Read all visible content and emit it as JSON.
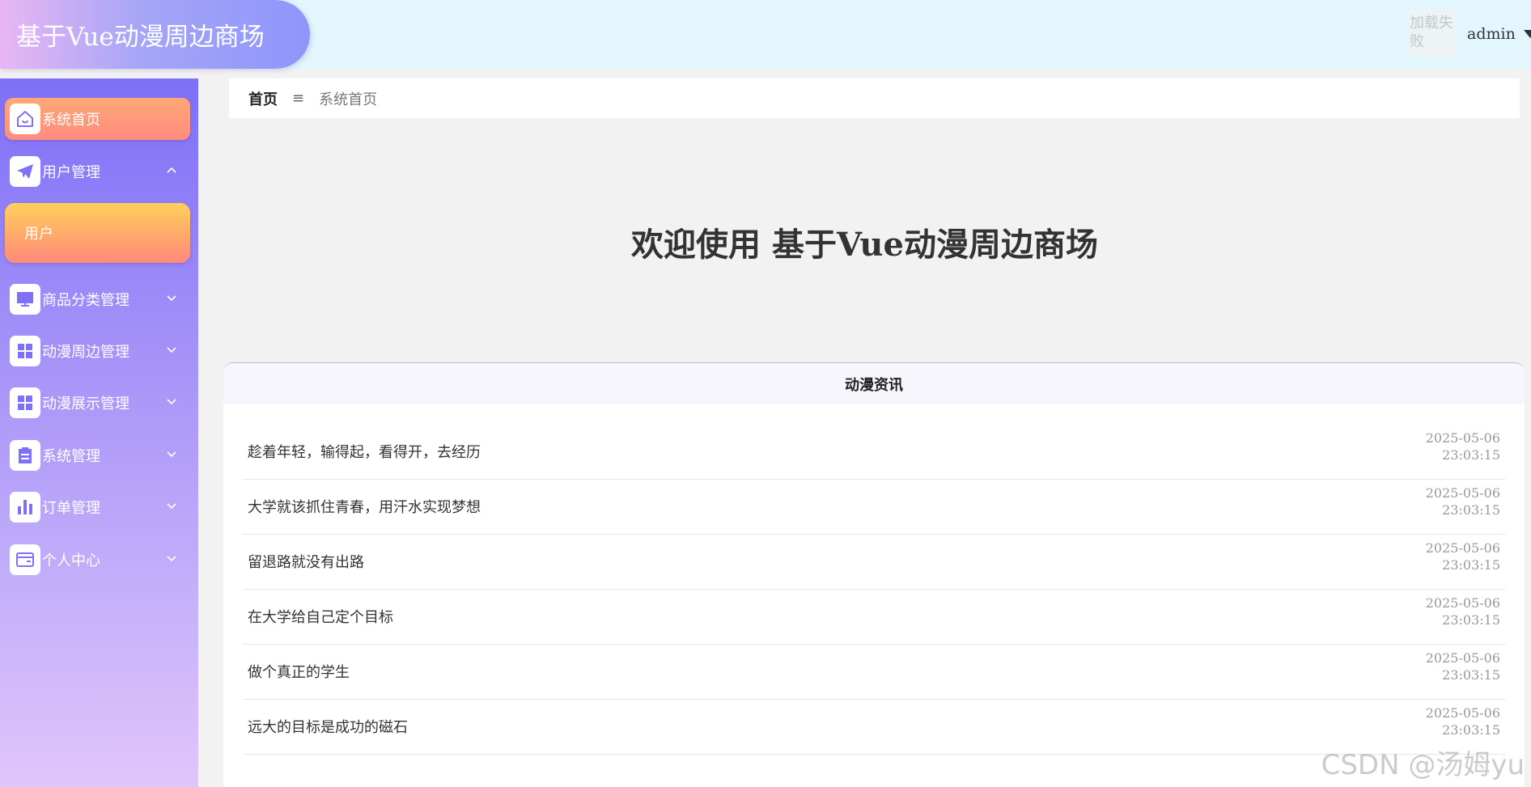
{
  "header": {
    "title": "基于Vue动漫周边商场",
    "avatar_alt": "加载失败",
    "username": "admin"
  },
  "sidebar": {
    "items": [
      {
        "label": "系统首页",
        "icon": "home-icon"
      },
      {
        "label": "用户管理",
        "icon": "paper-plane-icon"
      },
      {
        "label": "商品分类管理",
        "icon": "monitor-icon"
      },
      {
        "label": "动漫周边管理",
        "icon": "grid-icon"
      },
      {
        "label": "动漫展示管理",
        "icon": "grid-icon"
      },
      {
        "label": "系统管理",
        "icon": "clipboard-icon"
      },
      {
        "label": "订单管理",
        "icon": "bar-chart-icon"
      },
      {
        "label": "个人中心",
        "icon": "wallet-icon"
      }
    ],
    "subitems": {
      "user": "用户"
    }
  },
  "breadcrumb": {
    "home": "首页",
    "separator": "≡",
    "current": "系统首页"
  },
  "welcome": "欢迎使用 基于Vue动漫周边商场",
  "news": {
    "title": "动漫资讯",
    "items": [
      {
        "title": "趁着年轻，输得起，看得开，去经历",
        "date": "2025-05-06",
        "time": "23:03:15"
      },
      {
        "title": "大学就该抓住青春，用汗水实现梦想",
        "date": "2025-05-06",
        "time": "23:03:15"
      },
      {
        "title": "留退路就没有出路",
        "date": "2025-05-06",
        "time": "23:03:15"
      },
      {
        "title": "在大学给自己定个目标",
        "date": "2025-05-06",
        "time": "23:03:15"
      },
      {
        "title": "做个真正的学生",
        "date": "2025-05-06",
        "time": "23:03:15"
      },
      {
        "title": "远大的目标是成功的磁石",
        "date": "2025-05-06",
        "time": "23:03:15"
      }
    ]
  },
  "watermark": "CSDN @汤姆yu",
  "colors": {
    "accent": "#7e70f7",
    "active": "#ff8c7e",
    "header_bg": "#e3f6fd"
  }
}
